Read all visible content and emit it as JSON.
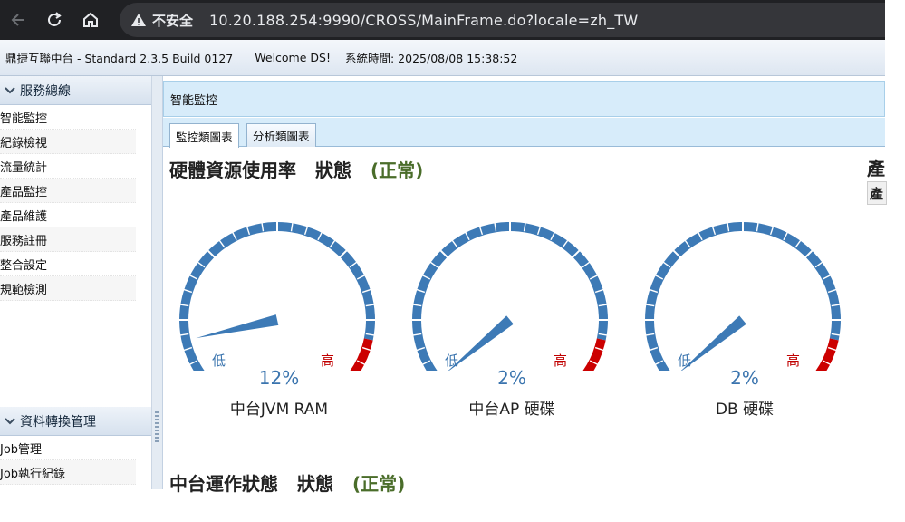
{
  "browser": {
    "security_label": "不安全",
    "url": "10.20.188.254:9990/CROSS/MainFrame.do?locale=zh_TW"
  },
  "appbar": {
    "product": "鼎捷互聯中台 - Standard 2.3.5 Build 0127",
    "welcome": "Welcome DS!",
    "system_time": "系統時間: 2025/08/08 15:38:52"
  },
  "sidebar": {
    "section1": {
      "title": "服務總線",
      "items": [
        "智能監控",
        "紀錄檢視",
        "流量統計",
        "產品監控",
        "產品維護",
        "服務註冊",
        "整合設定",
        "規範檢測"
      ]
    },
    "section2": {
      "title": "資料轉換管理",
      "items": [
        "Job管理",
        "Job執行紀錄"
      ]
    }
  },
  "main": {
    "panel_title": "智能監控",
    "tabs": [
      "監控類圖表",
      "分析類圖表"
    ],
    "section_hardware": {
      "title": "硬體資源使用率",
      "status_label": "狀態",
      "status_value": "(正常)"
    },
    "section_runtime": {
      "title": "中台運作狀態",
      "status_label": "狀態",
      "status_value": "(正常)"
    },
    "right_cut_title": "產",
    "right_cut_button": "產",
    "gauges": [
      {
        "name": "中台JVM RAM",
        "value_text": "12%",
        "percent": 12,
        "low": "低",
        "high": "高"
      },
      {
        "name": "中台AP 硬碟",
        "value_text": "2%",
        "percent": 2,
        "low": "低",
        "high": "高"
      },
      {
        "name": "DB 硬碟",
        "value_text": "2%",
        "percent": 2,
        "low": "低",
        "high": "高"
      }
    ]
  },
  "colors": {
    "gauge_blue": "#3d7ab6",
    "gauge_red": "#cc0000",
    "status_ok": "#4a6d2a"
  }
}
